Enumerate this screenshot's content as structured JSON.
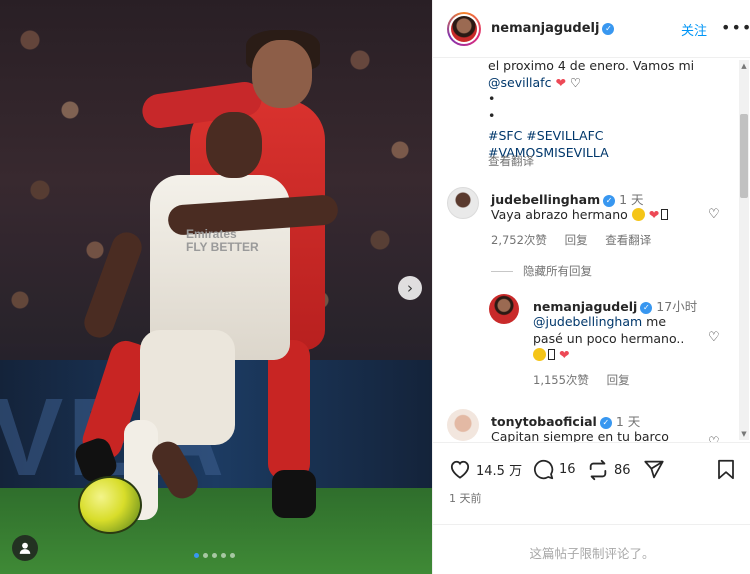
{
  "post": {
    "username": "nemanjagudelj",
    "follow_label": "关注",
    "more_icon": "more-horizontal-icon",
    "photo": {
      "shirt_text_line1": "Emirates",
      "shirt_text_line2": "FLY BETTER",
      "board_text": "VEA",
      "next_icon": "chevron-right-icon",
      "tag_icon": "user-tag-icon",
      "slide_count": 5,
      "active_slide": 1
    },
    "caption": {
      "line1": "el proximo 4 de enero. Vamos mi",
      "mention": "@sevillafc",
      "bullet1": "•",
      "bullet2": "•",
      "hashtags1": "#SFC #SEVILLAFC",
      "hashtags2": "#VAMOSMISEVILLA",
      "translate_label": "查看翻译"
    },
    "comments": [
      {
        "username": "judebellingham",
        "time": "1 天",
        "text": "Vaya abrazo hermano",
        "likes": "2,752次赞",
        "reply_label": "回复",
        "translate_label": "查看翻译"
      }
    ],
    "hide_replies_label": "隐藏所有回复",
    "reply": {
      "username": "nemanjagudelj",
      "time": "17小时",
      "mention": "@judebellingham",
      "text1": " me",
      "text2": "pasé un poco hermano..",
      "likes": "1,155次赞",
      "reply_label": "回复"
    },
    "comment3": {
      "username": "tonytobaoficial",
      "time": "1 天",
      "text": "Capitan siempre en tu barco"
    },
    "actions": {
      "likes": "14.5 万",
      "comments": "16",
      "reposts": "86"
    },
    "date": "1 天前",
    "comments_restricted": "这篇帖子限制评论了。"
  },
  "colors": {
    "accent": "#0095f6",
    "link": "#00376b",
    "heart": "#ed4956",
    "muted": "#737373"
  }
}
